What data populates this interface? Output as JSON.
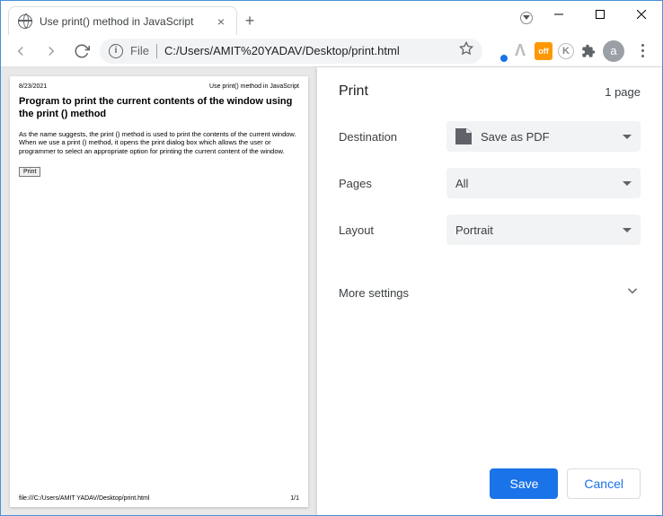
{
  "window": {
    "tab_title": "Use print() method in JavaScript",
    "url_protocol": "File",
    "url_path": "C:/Users/AMIT%20YADAV/Desktop/print.html",
    "avatar_letter": "a",
    "ext_off_label": "off"
  },
  "preview": {
    "date": "8/23/2021",
    "header_right": "Use print() method in JavaScript",
    "title": "Program to print the current contents of the window using the print () method",
    "body": "As the name suggests, the print () method is used to print the contents of the current window. When we use a print () method, it opens the print dialog box which allows the user or programmer to select an appropriate option for printing the current content of the window.",
    "button_label": "Print",
    "footer_left": "file:///C:/Users/AMIT YADAV/Desktop/print.html",
    "footer_right": "1/1"
  },
  "panel": {
    "title": "Print",
    "sheet_count": "1 page",
    "settings": {
      "destination_label": "Destination",
      "destination_value": "Save as PDF",
      "pages_label": "Pages",
      "pages_value": "All",
      "layout_label": "Layout",
      "layout_value": "Portrait"
    },
    "more_label": "More settings",
    "save_label": "Save",
    "cancel_label": "Cancel"
  }
}
